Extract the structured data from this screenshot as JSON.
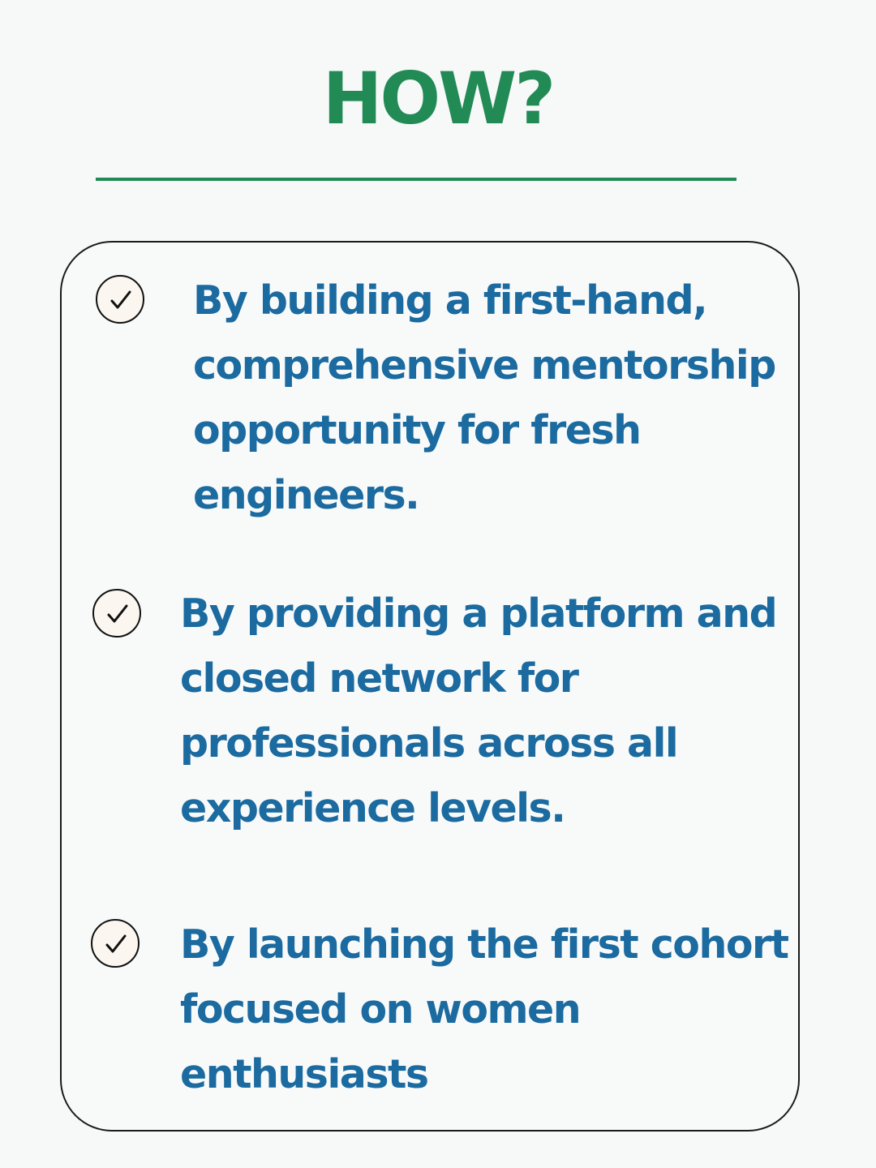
{
  "heading": "HOW?",
  "items": [
    {
      "text": "By building a first-hand,\ncomprehensive mentorship\nopportunity for fresh\nengineers."
    },
    {
      "text": "By providing a platform and\nclosed network for\nprofessionals across all\nexperience levels."
    },
    {
      "text": "By launching the first cohort\nfocused on women\nenthusiasts"
    }
  ],
  "icons": {
    "bullet": "check-circle-icon"
  },
  "colors": {
    "background": "#f6f9f8",
    "heading": "#228a55",
    "divider": "#228a55",
    "item_text": "#1b6aa0",
    "card_border": "#1a1a1a",
    "check_fill": "#fbf7f0"
  }
}
